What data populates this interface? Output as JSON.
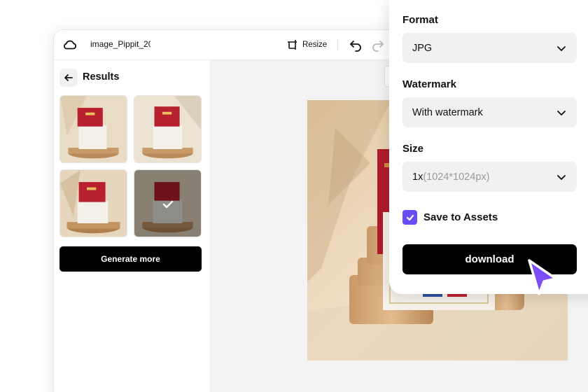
{
  "toolbar": {
    "filename": "image_Pippit_20",
    "resize_label": "Resize",
    "icons": [
      "cloud-icon",
      "resize-icon",
      "undo-icon",
      "redo-icon"
    ]
  },
  "results_panel": {
    "title": "Results",
    "thumbnails": [
      "result-1",
      "result-2",
      "result-3",
      "result-4"
    ],
    "selected_index": 3,
    "generate_more_label": "Generate more"
  },
  "export": {
    "format_label": "Format",
    "format_value": "JPG",
    "watermark_label": "Watermark",
    "watermark_value": "With watermark",
    "size_label": "Size",
    "size_value": "1x",
    "size_detail": "(1024*1024px)",
    "save_to_assets_label": "Save to Assets",
    "save_to_assets_checked": true,
    "download_label": "download"
  },
  "colors": {
    "accent": "#6a4cf5",
    "button_dark": "#000000",
    "select_bg": "#f1f1f1",
    "canvas_bg": "#f3f3f3"
  }
}
